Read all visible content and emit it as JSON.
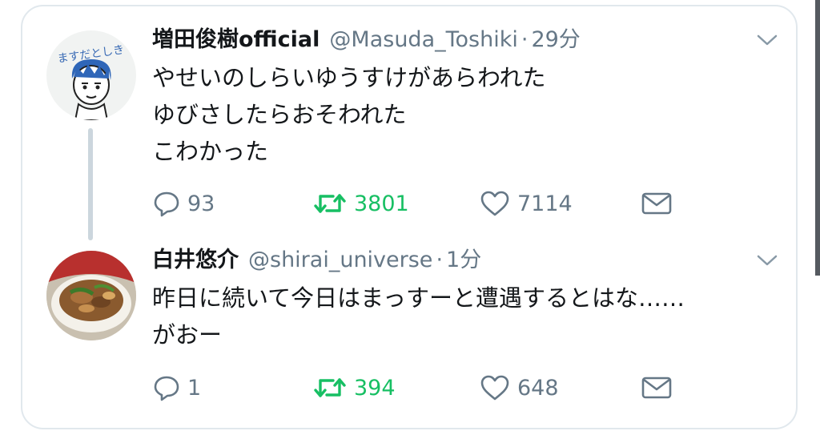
{
  "tweets": [
    {
      "display_name": "増田俊樹official",
      "handle": "@Masuda_Toshiki",
      "time": "29分",
      "lines": [
        "やせいのしらいゆうすけがあらわれた",
        "ゆびさしたらおそわれた",
        "こわかった"
      ],
      "replies": "93",
      "retweets": "3801",
      "likes": "7114",
      "avatar_text": "ますだとしき",
      "avatar_icon": "cartoon-face-avatar"
    },
    {
      "display_name": "白井悠介",
      "handle": "@shirai_universe",
      "time": "1分",
      "lines": [
        "昨日に続いて今日はまっすーと遭遇するとはな……",
        "がおー"
      ],
      "replies": "1",
      "retweets": "394",
      "likes": "648",
      "avatar_icon": "food-photo-avatar"
    }
  ],
  "separator": "·",
  "colors": {
    "retweet": "#17bf63",
    "muted": "#657786",
    "thread_line": "#ccd6dd",
    "border": "#e1e8ed"
  },
  "icons": [
    "reply-icon",
    "retweet-icon",
    "like-icon",
    "dm-icon",
    "chevron-down-icon"
  ]
}
